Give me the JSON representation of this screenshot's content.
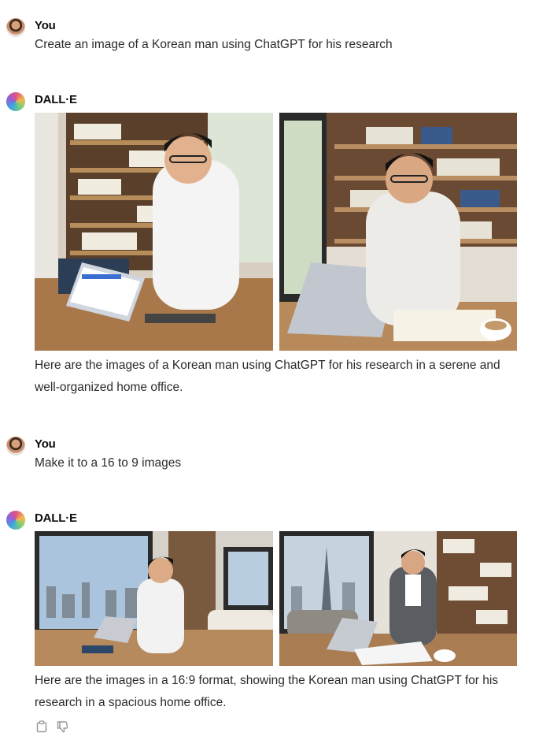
{
  "messages": [
    {
      "author": "You",
      "text": "Create an image of a Korean man using ChatGPT for his research"
    },
    {
      "author": "DALL·E",
      "images": [
        "Korean man at laptop, bookshelf office",
        "Korean man at laptop with coffee"
      ],
      "text": "Here are the images of a Korean man using ChatGPT for his research in a serene and well-organized home office."
    },
    {
      "author": "You",
      "text": "Make it to a 16 to 9 images"
    },
    {
      "author": "DALL·E",
      "images": [
        "Man at desk by city window",
        "Man in blazer by skyline window"
      ],
      "text": "Here are the images in a 16:9 format, showing the Korean man using ChatGPT for his research in a spacious home office."
    }
  ],
  "actions": {
    "copy_icon": "clipboard-icon",
    "dislike_icon": "thumbs-down-icon"
  }
}
